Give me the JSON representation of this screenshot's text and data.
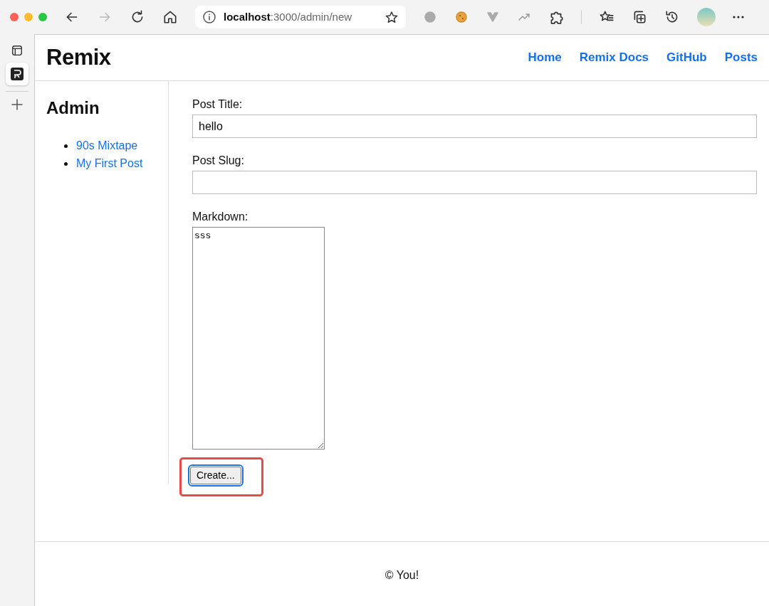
{
  "browser": {
    "address_host": "localhost",
    "address_path": ":3000/admin/new"
  },
  "header": {
    "logo": "Remix",
    "nav": [
      {
        "label": "Home"
      },
      {
        "label": "Remix Docs"
      },
      {
        "label": "GitHub"
      },
      {
        "label": "Posts"
      }
    ]
  },
  "sidebar": {
    "title": "Admin",
    "posts": [
      {
        "label": "90s Mixtape"
      },
      {
        "label": "My First Post"
      }
    ]
  },
  "form": {
    "fields": [
      {
        "kind": "text",
        "label": "Post Title:",
        "value": "hello"
      },
      {
        "kind": "text",
        "label": "Post Slug:"
      },
      {
        "kind": "textarea",
        "label": "Markdown:",
        "value": "sss"
      }
    ],
    "submit": {
      "label": "Create...",
      "highlighted": true
    }
  },
  "footer": {
    "text": "© You!"
  }
}
